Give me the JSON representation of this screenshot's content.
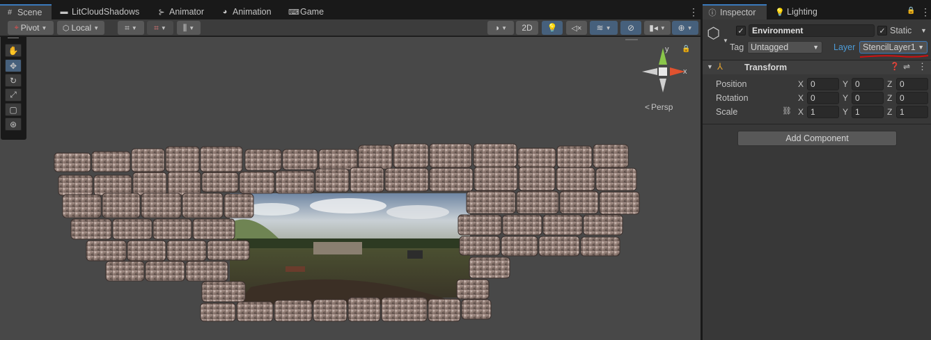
{
  "scene_tabs": [
    {
      "label": "Scene",
      "icon": "grid-icon"
    },
    {
      "label": "LitCloudShadows",
      "icon": "tab-icon"
    },
    {
      "label": "Animator",
      "icon": "animator-icon"
    },
    {
      "label": "Animation",
      "icon": "animation-icon"
    },
    {
      "label": "Game",
      "icon": "gamepad-icon"
    }
  ],
  "toolbar": {
    "pivot_label": "Pivot",
    "local_label": "Local",
    "mode_2d_label": "2D"
  },
  "gizmo": {
    "x_label": "x",
    "y_label": "y",
    "persp_label": "Persp"
  },
  "inspector": {
    "tabs": [
      {
        "label": "Inspector",
        "icon": "info-icon"
      },
      {
        "label": "Lighting",
        "icon": "bulb-icon"
      }
    ],
    "object_name": "Environment",
    "active_checked": true,
    "static_label": "Static",
    "static_checked": true,
    "tag_label": "Tag",
    "tag_value": "Untagged",
    "layer_label": "Layer",
    "layer_value": "StencilLayer1",
    "annotation_color": "#d11010",
    "component_title": "Transform",
    "rows": [
      {
        "label": "Position",
        "x": "0",
        "y": "0",
        "z": "0"
      },
      {
        "label": "Rotation",
        "x": "0",
        "y": "0",
        "z": "0"
      },
      {
        "label": "Scale",
        "x": "1",
        "y": "1",
        "z": "1"
      }
    ],
    "axis_x": "X",
    "axis_y": "Y",
    "axis_z": "Z",
    "add_component_label": "Add Component"
  },
  "colors": {
    "accent": "#3a79bb",
    "panel": "#383838",
    "viewport": "#484848"
  }
}
